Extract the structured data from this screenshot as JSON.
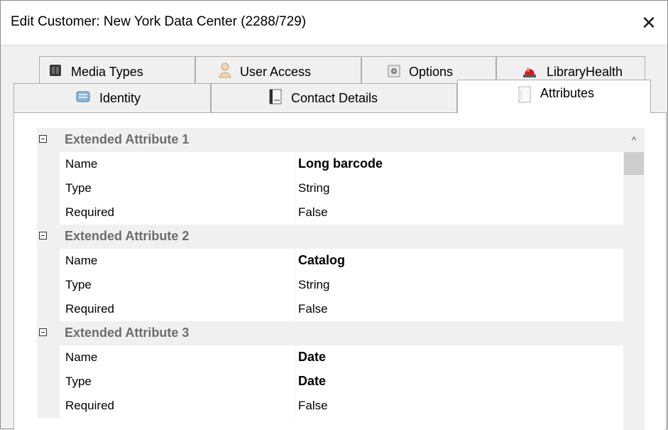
{
  "window": {
    "title": "Edit Customer: New York Data Center (2288/729)",
    "close_glyph": "✕"
  },
  "tabs": {
    "row1": [
      {
        "label": "Media Types",
        "icon": "media-types-icon"
      },
      {
        "label": "User Access",
        "icon": "user-icon"
      },
      {
        "label": "Options",
        "icon": "options-icon"
      },
      {
        "label": "LibraryHealth",
        "icon": "alarm-light-icon"
      }
    ],
    "row2": [
      {
        "label": "Identity",
        "icon": "identity-icon"
      },
      {
        "label": "Contact Details",
        "icon": "contact-book-icon"
      },
      {
        "label": "Attributes",
        "icon": "attributes-page-icon",
        "active": true
      }
    ]
  },
  "grid": {
    "categories": [
      {
        "label": "Extended Attribute 1",
        "rows": [
          {
            "name": "Name",
            "value": "Long barcode",
            "bold": true
          },
          {
            "name": "Type",
            "value": "String",
            "bold": false
          },
          {
            "name": "Required",
            "value": "False",
            "bold": false
          }
        ]
      },
      {
        "label": "Extended Attribute 2",
        "rows": [
          {
            "name": "Name",
            "value": "Catalog",
            "bold": true
          },
          {
            "name": "Type",
            "value": "String",
            "bold": false
          },
          {
            "name": "Required",
            "value": "False",
            "bold": false
          }
        ]
      },
      {
        "label": "Extended Attribute 3",
        "rows": [
          {
            "name": "Name",
            "value": "Date",
            "bold": true
          },
          {
            "name": "Type",
            "value": "Date",
            "bold": true
          },
          {
            "name": "Required",
            "value": "False",
            "bold": false
          }
        ]
      }
    ]
  },
  "scrollbar": {
    "up_glyph": "^"
  },
  "colors": {
    "category_text": "#6d6d6d",
    "category_background": "#f0f0f0",
    "scroll_thumb": "#cdcdcd"
  }
}
